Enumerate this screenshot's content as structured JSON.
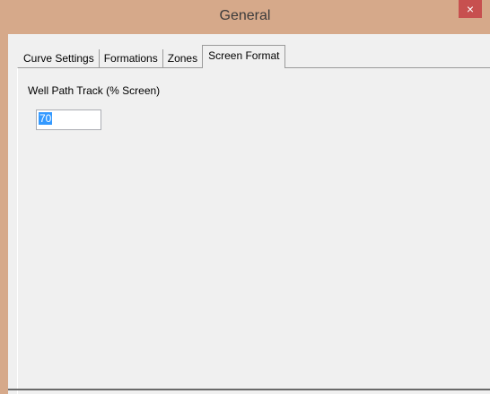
{
  "window": {
    "title": "General",
    "close_label": "×"
  },
  "tabs": [
    {
      "label": "Curve Settings",
      "active": false
    },
    {
      "label": "Formations",
      "active": false
    },
    {
      "label": "Zones",
      "active": false
    },
    {
      "label": "Screen Format",
      "active": true
    }
  ],
  "screen_format": {
    "well_path_label": "Well Path Track (% Screen)",
    "well_path_value": "70"
  },
  "colors": {
    "title_bar": "#d6a98a",
    "close_button": "#c7504f",
    "panel": "#f0f0f0",
    "selection": "#3399ff"
  }
}
